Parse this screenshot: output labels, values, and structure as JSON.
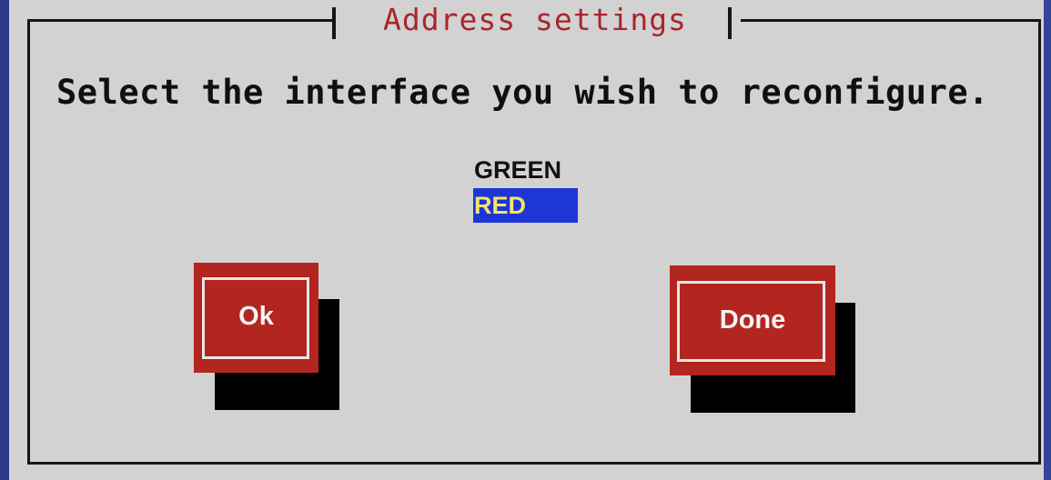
{
  "dialog": {
    "title": "Address settings",
    "prompt": "Select the interface you wish to reconfigure."
  },
  "interfaces": {
    "items": [
      "GREEN",
      "RED"
    ],
    "selected": "RED"
  },
  "buttons": {
    "ok_label": "Ok",
    "done_label": "Done"
  },
  "colors": {
    "background": "#d2d2d2",
    "title": "#a8262a",
    "button": "#b3261f",
    "selection": "#1f36d6",
    "selection_text": "#f2e56a",
    "screen_border": "#2b3a8c"
  }
}
